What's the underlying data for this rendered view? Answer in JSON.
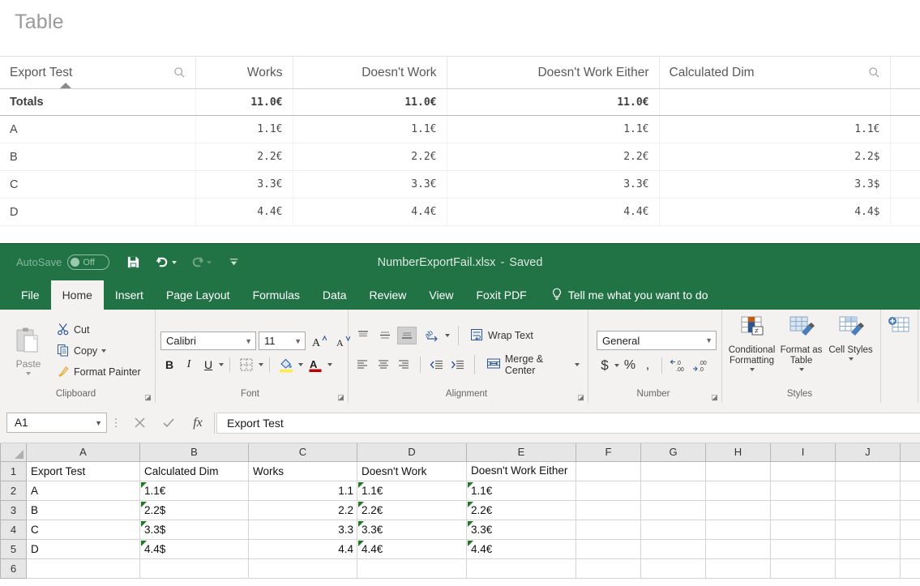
{
  "qlik": {
    "title": "Table",
    "columns": [
      {
        "label": "Export Test",
        "align": "left",
        "search_icon": "search-icon",
        "sorted": true
      },
      {
        "label": "Works",
        "align": "right",
        "search_icon": null,
        "sorted": false
      },
      {
        "label": "Doesn't Work",
        "align": "right",
        "search_icon": null,
        "sorted": false
      },
      {
        "label": "Doesn't Work Either",
        "align": "right",
        "search_icon": null,
        "sorted": false
      },
      {
        "label": "Calculated Dim",
        "align": "left",
        "search_icon": "search-icon",
        "sorted": false
      },
      {
        "label": "",
        "align": "left",
        "search_icon": null,
        "sorted": false
      }
    ],
    "totals_row": {
      "label": "Totals",
      "values": [
        "11.0€",
        "11.0€",
        "11.0€",
        "",
        ""
      ]
    },
    "rows": [
      {
        "dim": "A",
        "values": [
          "1.1€",
          "1.1€",
          "1.1€",
          "1.1€",
          ""
        ]
      },
      {
        "dim": "B",
        "values": [
          "2.2€",
          "2.2€",
          "2.2€",
          "2.2$",
          ""
        ]
      },
      {
        "dim": "C",
        "values": [
          "3.3€",
          "3.3€",
          "3.3€",
          "3.3$",
          ""
        ]
      },
      {
        "dim": "D",
        "values": [
          "4.4€",
          "4.4€",
          "4.4€",
          "4.4$",
          ""
        ]
      }
    ]
  },
  "excel": {
    "titlebar": {
      "autosave_label": "AutoSave",
      "autosave_state": "Off",
      "save_icon": "save-icon",
      "undo_icon": "undo-icon",
      "redo_icon": "redo-icon",
      "customize_icon": "customize-quick-access-icon",
      "document_name": "NumberExportFail.xlsx",
      "separator": "-",
      "save_status": "Saved"
    },
    "tabs": [
      {
        "label": "File",
        "active": false
      },
      {
        "label": "Home",
        "active": true
      },
      {
        "label": "Insert",
        "active": false
      },
      {
        "label": "Page Layout",
        "active": false
      },
      {
        "label": "Formulas",
        "active": false
      },
      {
        "label": "Data",
        "active": false
      },
      {
        "label": "Review",
        "active": false
      },
      {
        "label": "View",
        "active": false
      },
      {
        "label": "Foxit PDF",
        "active": false
      }
    ],
    "tell_me": "Tell me what you want to do",
    "ribbon": {
      "clipboard": {
        "group_label": "Clipboard",
        "paste_label": "Paste",
        "cut_label": "Cut",
        "copy_label": "Copy",
        "format_painter_label": "Format Painter"
      },
      "font": {
        "group_label": "Font",
        "font_name": "Calibri",
        "font_size": "11",
        "bold_label": "B",
        "italic_label": "I",
        "underline_label": "U",
        "increase_size_label": "A",
        "decrease_size_label": "A",
        "fill_color_label": "A",
        "font_color_label": "A"
      },
      "alignment": {
        "group_label": "Alignment",
        "wrap_text_label": "Wrap Text",
        "merge_center_label": "Merge & Center"
      },
      "number": {
        "group_label": "Number",
        "format_value": "General",
        "currency_label": "$",
        "percent_label": "%",
        "comma_label": ",",
        "increase_decimal_label": ".00",
        "decrease_decimal_label": ".00"
      },
      "styles": {
        "group_label": "Styles",
        "conditional_formatting_label": "Conditional Formatting",
        "format_as_table_label": "Format as Table",
        "cell_styles_label": "Cell Styles"
      }
    },
    "formula_bar": {
      "name_box": "A1",
      "cancel_icon": "cancel-icon",
      "enter_icon": "confirm-icon",
      "function_icon": "insert-function-icon",
      "formula_value": "Export Test"
    },
    "sheet": {
      "column_headers": [
        "A",
        "B",
        "C",
        "D",
        "E",
        "F",
        "G",
        "H",
        "I",
        "J"
      ],
      "row_headers": [
        "1",
        "2",
        "3",
        "4",
        "5",
        "6"
      ],
      "rows": [
        [
          {
            "v": "Export Test",
            "a": "txt",
            "err": false
          },
          {
            "v": "Calculated Dim",
            "a": "txt",
            "err": false
          },
          {
            "v": "Works",
            "a": "txt",
            "err": false
          },
          {
            "v": "Doesn't Work",
            "a": "txt",
            "err": false
          },
          {
            "v": "Doesn't Work Either",
            "a": "txt",
            "err": false
          },
          {
            "v": "",
            "a": "txt",
            "err": false
          },
          {
            "v": "",
            "a": "txt",
            "err": false
          },
          {
            "v": "",
            "a": "txt",
            "err": false
          },
          {
            "v": "",
            "a": "txt",
            "err": false
          },
          {
            "v": "",
            "a": "txt",
            "err": false
          }
        ],
        [
          {
            "v": "A",
            "a": "txt",
            "err": false
          },
          {
            "v": "1.1€",
            "a": "txt",
            "err": true
          },
          {
            "v": "1.1",
            "a": "num",
            "err": false
          },
          {
            "v": "1.1€",
            "a": "txt",
            "err": true
          },
          {
            "v": "1.1€",
            "a": "txt",
            "err": true
          },
          {
            "v": "",
            "a": "txt",
            "err": false
          },
          {
            "v": "",
            "a": "txt",
            "err": false
          },
          {
            "v": "",
            "a": "txt",
            "err": false
          },
          {
            "v": "",
            "a": "txt",
            "err": false
          },
          {
            "v": "",
            "a": "txt",
            "err": false
          }
        ],
        [
          {
            "v": "B",
            "a": "txt",
            "err": false
          },
          {
            "v": "2.2$",
            "a": "txt",
            "err": true
          },
          {
            "v": "2.2",
            "a": "num",
            "err": false
          },
          {
            "v": "2.2€",
            "a": "txt",
            "err": true
          },
          {
            "v": "2.2€",
            "a": "txt",
            "err": true
          },
          {
            "v": "",
            "a": "txt",
            "err": false
          },
          {
            "v": "",
            "a": "txt",
            "err": false
          },
          {
            "v": "",
            "a": "txt",
            "err": false
          },
          {
            "v": "",
            "a": "txt",
            "err": false
          },
          {
            "v": "",
            "a": "txt",
            "err": false
          }
        ],
        [
          {
            "v": "C",
            "a": "txt",
            "err": false
          },
          {
            "v": "3.3$",
            "a": "txt",
            "err": true
          },
          {
            "v": "3.3",
            "a": "num",
            "err": false
          },
          {
            "v": "3.3€",
            "a": "txt",
            "err": true
          },
          {
            "v": "3.3€",
            "a": "txt",
            "err": true
          },
          {
            "v": "",
            "a": "txt",
            "err": false
          },
          {
            "v": "",
            "a": "txt",
            "err": false
          },
          {
            "v": "",
            "a": "txt",
            "err": false
          },
          {
            "v": "",
            "a": "txt",
            "err": false
          },
          {
            "v": "",
            "a": "txt",
            "err": false
          }
        ],
        [
          {
            "v": "D",
            "a": "txt",
            "err": false
          },
          {
            "v": "4.4$",
            "a": "txt",
            "err": true
          },
          {
            "v": "4.4",
            "a": "num",
            "err": false
          },
          {
            "v": "4.4€",
            "a": "txt",
            "err": true
          },
          {
            "v": "4.4€",
            "a": "txt",
            "err": true
          },
          {
            "v": "",
            "a": "txt",
            "err": false
          },
          {
            "v": "",
            "a": "txt",
            "err": false
          },
          {
            "v": "",
            "a": "txt",
            "err": false
          },
          {
            "v": "",
            "a": "txt",
            "err": false
          },
          {
            "v": "",
            "a": "txt",
            "err": false
          }
        ],
        [
          {
            "v": "",
            "a": "txt",
            "err": false
          },
          {
            "v": "",
            "a": "txt",
            "err": false
          },
          {
            "v": "",
            "a": "txt",
            "err": false
          },
          {
            "v": "",
            "a": "txt",
            "err": false
          },
          {
            "v": "",
            "a": "txt",
            "err": false
          },
          {
            "v": "",
            "a": "txt",
            "err": false
          },
          {
            "v": "",
            "a": "txt",
            "err": false
          },
          {
            "v": "",
            "a": "txt",
            "err": false
          },
          {
            "v": "",
            "a": "txt",
            "err": false
          },
          {
            "v": "",
            "a": "txt",
            "err": false
          }
        ]
      ]
    }
  },
  "colors": {
    "excel_green": "#217346",
    "ribbon_bg": "#f3f2f1",
    "error_flag_green": "#1e7a1e",
    "accent_blue": "#2b579a"
  }
}
